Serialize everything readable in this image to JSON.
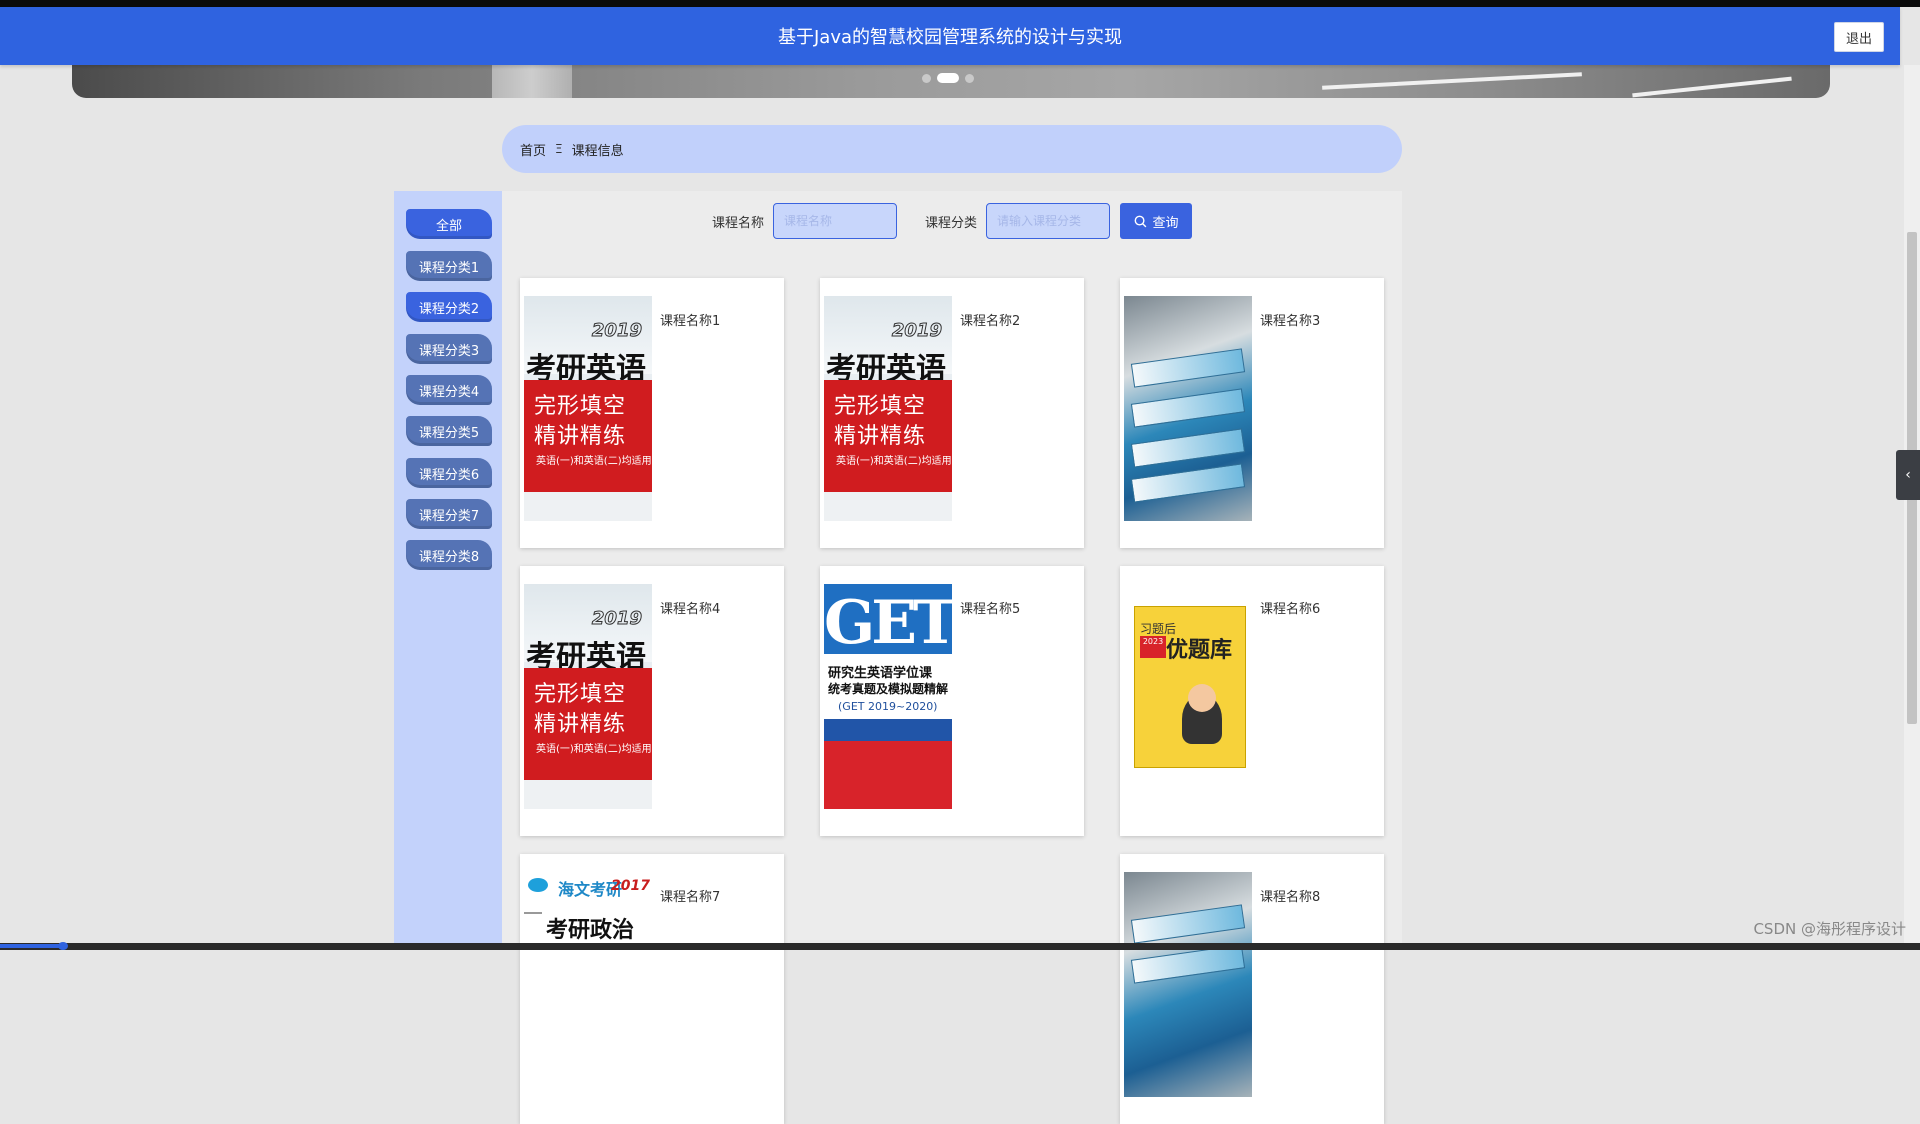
{
  "header": {
    "title": "基于Java的智慧校园管理系统的设计与实现",
    "logout_label": "退出"
  },
  "breadcrumb": {
    "home": "首页",
    "separator": "Ξ",
    "current": "课程信息"
  },
  "sidebar": {
    "items": [
      {
        "label": "全部",
        "active": true
      },
      {
        "label": "课程分类1"
      },
      {
        "label": "课程分类2"
      },
      {
        "label": "课程分类3"
      },
      {
        "label": "课程分类4"
      },
      {
        "label": "课程分类5"
      },
      {
        "label": "课程分类6"
      },
      {
        "label": "课程分类7"
      },
      {
        "label": "课程分类8"
      }
    ]
  },
  "search": {
    "name_label": "课程名称",
    "name_placeholder": "课程名称",
    "category_label": "课程分类",
    "category_placeholder": "请输入课程分类",
    "query_label": "查询",
    "query_icon": "search-icon"
  },
  "cards": [
    {
      "name": "课程名称1",
      "cover": "kaoyan-english"
    },
    {
      "name": "课程名称2",
      "cover": "kaoyan-english"
    },
    {
      "name": "课程名称3",
      "cover": "book-pile"
    },
    {
      "name": "课程名称4",
      "cover": "kaoyan-english"
    },
    {
      "name": "课程名称5",
      "cover": "get-exam"
    },
    {
      "name": "课程名称6",
      "cover": "yellow-question-bank"
    },
    {
      "name": "课程名称7",
      "cover": "kaoyan-politics"
    },
    {
      "name": "课程名称8",
      "cover": "book-pile"
    }
  ],
  "covers": {
    "kaoyan": {
      "year": "2019",
      "title": "考研英语",
      "line1": "完形填空",
      "line2": "精讲精练",
      "line3": "英语(一)和英语(二)均适用"
    },
    "get": {
      "big": "GET",
      "line1": "研究生英语学位课",
      "line2": "统考真题及模拟题精解",
      "line3": "(GET 2019~2020)"
    },
    "yellow": {
      "head": "习题后",
      "year_badge": "2023",
      "title": "优题库"
    },
    "politics": {
      "brand": "海文考研",
      "year": "2017",
      "title": "考研政治"
    }
  },
  "right_tab_icon": "chevron-left-icon",
  "watermark": "CSDN @海彤程序设计"
}
